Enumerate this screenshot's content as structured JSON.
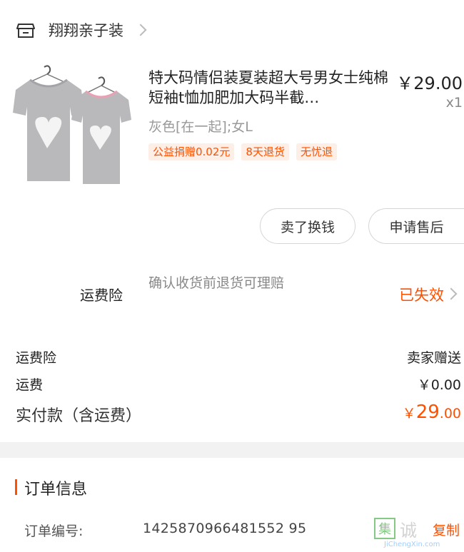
{
  "store": {
    "name": "翔翔亲子装",
    "icon": "store-icon"
  },
  "product": {
    "title": "特大码情侣装夏装超大号男女士纯棉短袖t恤加肥加大码半截…",
    "price": "￥29.00",
    "quantity": "x1",
    "sku": "灰色[在一起];女L",
    "tags": [
      "公益捐赠0.02元",
      "8天退货",
      "无忧退"
    ]
  },
  "actions": {
    "sell": "卖了换钱",
    "after_sale": "申请售后"
  },
  "insurance": {
    "label": "运费险",
    "description": "确认收货前退货可理赔",
    "status": "已失效"
  },
  "summary": {
    "rows": [
      {
        "label": "运费险",
        "value": "卖家赠送"
      },
      {
        "label": "运费",
        "value": "￥0.00"
      }
    ],
    "total_label": "实付款（含运费）",
    "total_symbol": "￥",
    "total_integer": "29",
    "total_decimal": ".00"
  },
  "order_info": {
    "title": "订单信息",
    "number_label": "订单编号:",
    "number_value": "1425870966481552 95",
    "copy_label": "复制"
  },
  "watermark": {
    "box": "集",
    "cn": "诚",
    "en": "JiChengXin.com"
  },
  "colors": {
    "accent": "#ff5000",
    "tag_bg": "#fdeee6",
    "divider": "#f2f2f2"
  }
}
